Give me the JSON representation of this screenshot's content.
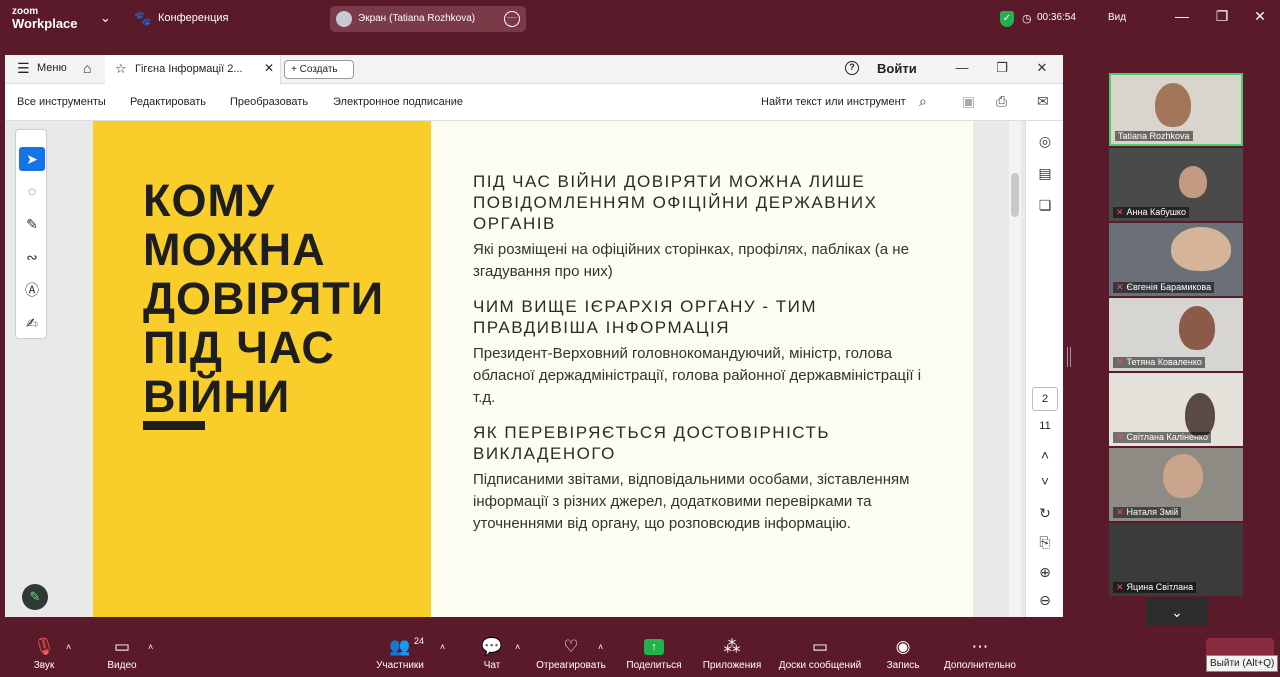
{
  "zoom": {
    "logo_top": "zoom",
    "logo_bottom": "Workplace",
    "meeting_label": "Конференция",
    "share_label": "Экран (Tatiana Rozhkova)",
    "timer": "00:36:54",
    "view_label": "Вид"
  },
  "window": {
    "menu_label": "Меню",
    "tab_title": "Гігєна Інформації 2...",
    "create_label": "Создать",
    "login_label": "Войти",
    "toolbar": [
      "Все инструменты",
      "Редактировать",
      "Преобразовать",
      "Электронное подписание"
    ],
    "search_label": "Найти текст или инструмент",
    "page_current": "2",
    "page_total": "11"
  },
  "slide": {
    "title_lines": [
      "КОМУ",
      "МОЖНА",
      "ДОВІРЯТИ",
      "ПІД ЧАС",
      "ВІЙНИ"
    ],
    "sections": [
      {
        "heading": "ПІД ЧАС ВІЙНИ ДОВІРЯТИ МОЖНА ЛИШЕ ПОВІДОМЛЕННЯМ ОФІЦІЙНИ ДЕРЖАВНИХ ОРГАНІВ",
        "text": "Які розміщені на офіційних сторінках, профілях, пабліках (а не згадування про них)"
      },
      {
        "heading": "ЧИМ ВИЩЕ ІЄРАРХІЯ ОРГАНУ - ТИМ ПРАВДИВІША ІНФОРМАЦІЯ",
        "text": "Президент-Верховний головнокомандуючий, міністр, голова обласної держадміністрації, голова районної державміністрації і т.д."
      },
      {
        "heading": "ЯК ПЕРЕВІРЯЄТЬСЯ ДОСТОВІРНІСТЬ ВИКЛАДЕНОГО",
        "text": "Підписаними звітами, відповідальними особами, зіставленням інформації з різних джерел, додатковими перевірками та уточненнями від органу, що розповсюдив інформацію."
      }
    ]
  },
  "participants": [
    {
      "name": "Tatiana Rozhkova",
      "muted": false
    },
    {
      "name": "Анна Кабушко",
      "muted": true
    },
    {
      "name": "Євгенія Барамикова",
      "muted": true
    },
    {
      "name": "Тетяна Коваленко",
      "muted": true
    },
    {
      "name": "Світлана Каліненко",
      "muted": true
    },
    {
      "name": "Наталя Змій",
      "muted": true
    },
    {
      "name": "Яцина Світлана",
      "muted": true
    }
  ],
  "bottombar": {
    "audio": "Звук",
    "video": "Видео",
    "participants": "Участники",
    "participants_count": "24",
    "chat": "Чат",
    "react": "Отреагировать",
    "share": "Поделиться",
    "apps": "Приложения",
    "whiteboards": "Доски сообщений",
    "record": "Запись",
    "more": "Дополнительно",
    "leave_tooltip": "Выйти (Alt+Q)"
  }
}
